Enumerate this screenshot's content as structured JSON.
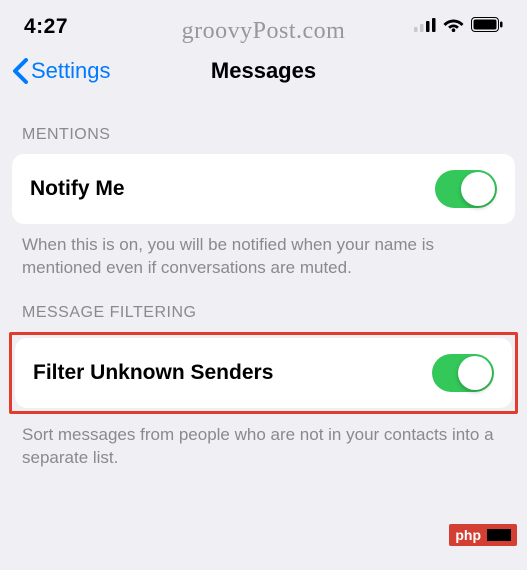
{
  "watermark": "groovyPost.com",
  "status": {
    "time": "4:27"
  },
  "nav": {
    "back_label": "Settings",
    "title": "Messages"
  },
  "sections": {
    "mentions": {
      "header": "MENTIONS",
      "item_label": "Notify Me",
      "toggle_on": true,
      "footer": "When this is on, you will be notified when your name is mentioned even if conversations are muted."
    },
    "filtering": {
      "header": "MESSAGE FILTERING",
      "item_label": "Filter Unknown Senders",
      "toggle_on": true,
      "footer": "Sort messages from people who are not in your contacts into a separate list."
    }
  },
  "badge": {
    "text": "php"
  }
}
